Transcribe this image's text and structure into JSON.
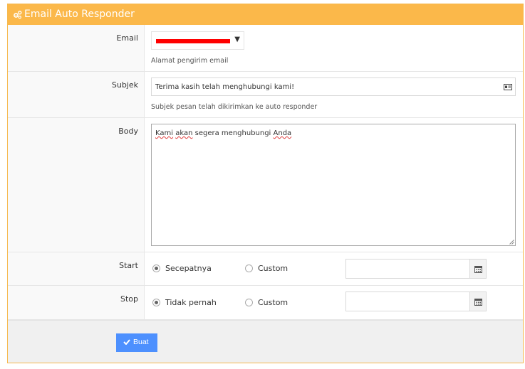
{
  "header": {
    "title": "Email Auto Responder",
    "icon": "cogs-icon"
  },
  "fields": {
    "email": {
      "label": "Email",
      "help": "Alamat pengirim email"
    },
    "subject": {
      "label": "Subjek",
      "value": "Terima kasih telah menghubungi kami!",
      "help": "Subjek pesan telah dikirimkan ke auto responder"
    },
    "body": {
      "label": "Body",
      "words": [
        "Kami",
        "akan",
        "segera",
        "menghubungi",
        "Anda"
      ]
    },
    "start": {
      "label": "Start",
      "option_1": "Secepatnya",
      "option_2": "Custom",
      "selected": "Secepatnya"
    },
    "stop": {
      "label": "Stop",
      "option_1": "Tidak pernah",
      "option_2": "Custom",
      "selected": "Tidak pernah"
    }
  },
  "footer": {
    "submit_label": "Buat"
  },
  "colors": {
    "header": "#fbb84a",
    "primary_button": "#4d90fe",
    "redaction": "#ff0000"
  }
}
